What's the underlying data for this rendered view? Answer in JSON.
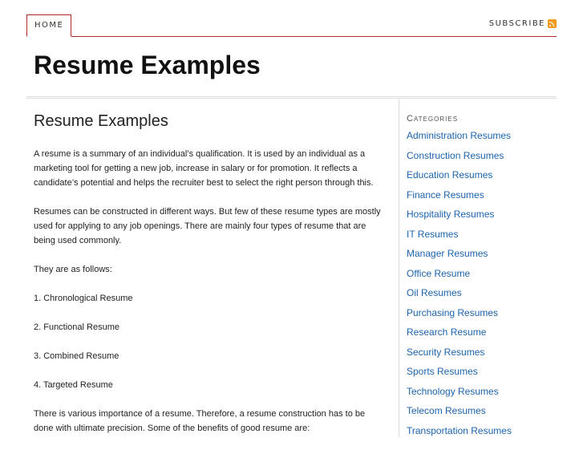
{
  "nav": {
    "home_label": "HOME",
    "subscribe_label": "SUBSCRIBE",
    "subscribe_icon": "rss-icon"
  },
  "site": {
    "title": "Resume Examples"
  },
  "post": {
    "title": "Resume Examples",
    "paragraphs": [
      "A resume is a summary of an individual’s qualification. It is used by an individual as a marketing tool for getting a new job, increase in salary or for promotion. It reflects a candidate’s potential and helps the recruiter best to select the right person through this.",
      "Resumes can be constructed in different ways. But few of these resume types are mostly used for applying to any job openings. There are mainly four types of resume that are being used commonly.",
      "They are as follows:",
      "1. Chronological Resume",
      "2. Functional Resume",
      "3. Combined Resume",
      "4. Targeted Resume",
      "There is various importance of a resume. Therefore, a resume construction has to be done with ultimate precision. Some of the benefits of good resume are:"
    ]
  },
  "sidebar": {
    "heading": "Categories",
    "categories": [
      "Administration Resumes",
      "Construction Resumes",
      "Education Resumes",
      "Finance Resumes",
      "Hospitality Resumes",
      "IT Resumes",
      "Manager Resumes",
      "Office Resume",
      "Oil Resumes",
      "Purchasing Resumes",
      "Research Resume",
      "Security Resumes",
      "Sports Resumes",
      "Technology Resumes",
      "Telecom Resumes",
      "Transportation Resumes"
    ]
  },
  "colors": {
    "accent_red": "#b0282c",
    "link_blue": "#1c63ac",
    "rss_orange": "#f39a1f"
  }
}
